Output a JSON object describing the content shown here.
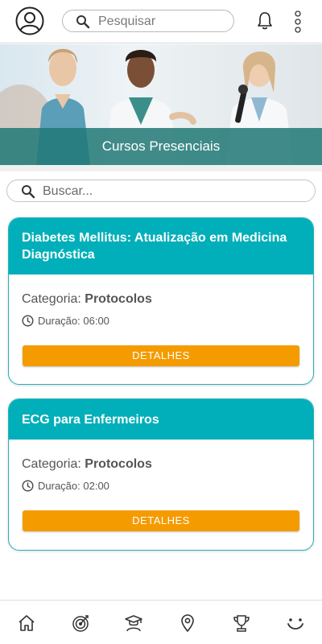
{
  "header": {
    "search_placeholder": "Pesquisar"
  },
  "banner": {
    "title": "Cursos Presenciais"
  },
  "search": {
    "placeholder": "Buscar..."
  },
  "courses": [
    {
      "title": "Diabetes Mellitus: Atualização em Medicina Diagnóstica",
      "category_label": "Categoria:",
      "category_value": "Protocolos",
      "duration_label": "Duração:",
      "duration_value": "06:00",
      "button_label": "DETALHES"
    },
    {
      "title": "ECG para Enfermeiros",
      "category_label": "Categoria:",
      "category_value": "Protocolos",
      "duration_label": "Duração:",
      "duration_value": "02:00",
      "button_label": "DETALHES"
    }
  ],
  "bottom_nav": {
    "items": [
      "home-icon",
      "target-icon",
      "graduation-icon",
      "location-pin-icon",
      "trophy-icon",
      "smile-icon"
    ]
  },
  "colors": {
    "accent": "#00afb9",
    "button": "#f49b00",
    "banner_strip": "#207876"
  }
}
